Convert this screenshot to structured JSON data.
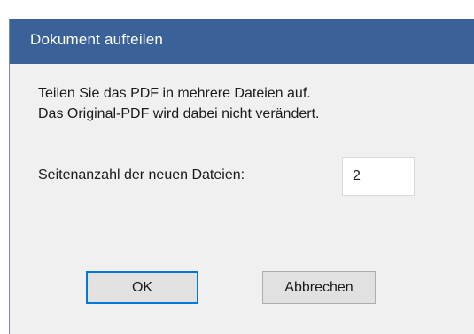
{
  "dialog": {
    "title": "Dokument aufteilen",
    "description_line1": "Teilen Sie das PDF in mehrere Dateien auf.",
    "description_line2": "Das Original-PDF wird dabei nicht verändert.",
    "pages_label": "Seitenanzahl der neuen Dateien:",
    "pages_value": "2",
    "ok_label": "OK",
    "cancel_label": "Abbrechen"
  },
  "colors": {
    "titlebar": "#3a6298",
    "dialog_background": "#f0f0f0",
    "default_button_border": "#0078d7"
  }
}
